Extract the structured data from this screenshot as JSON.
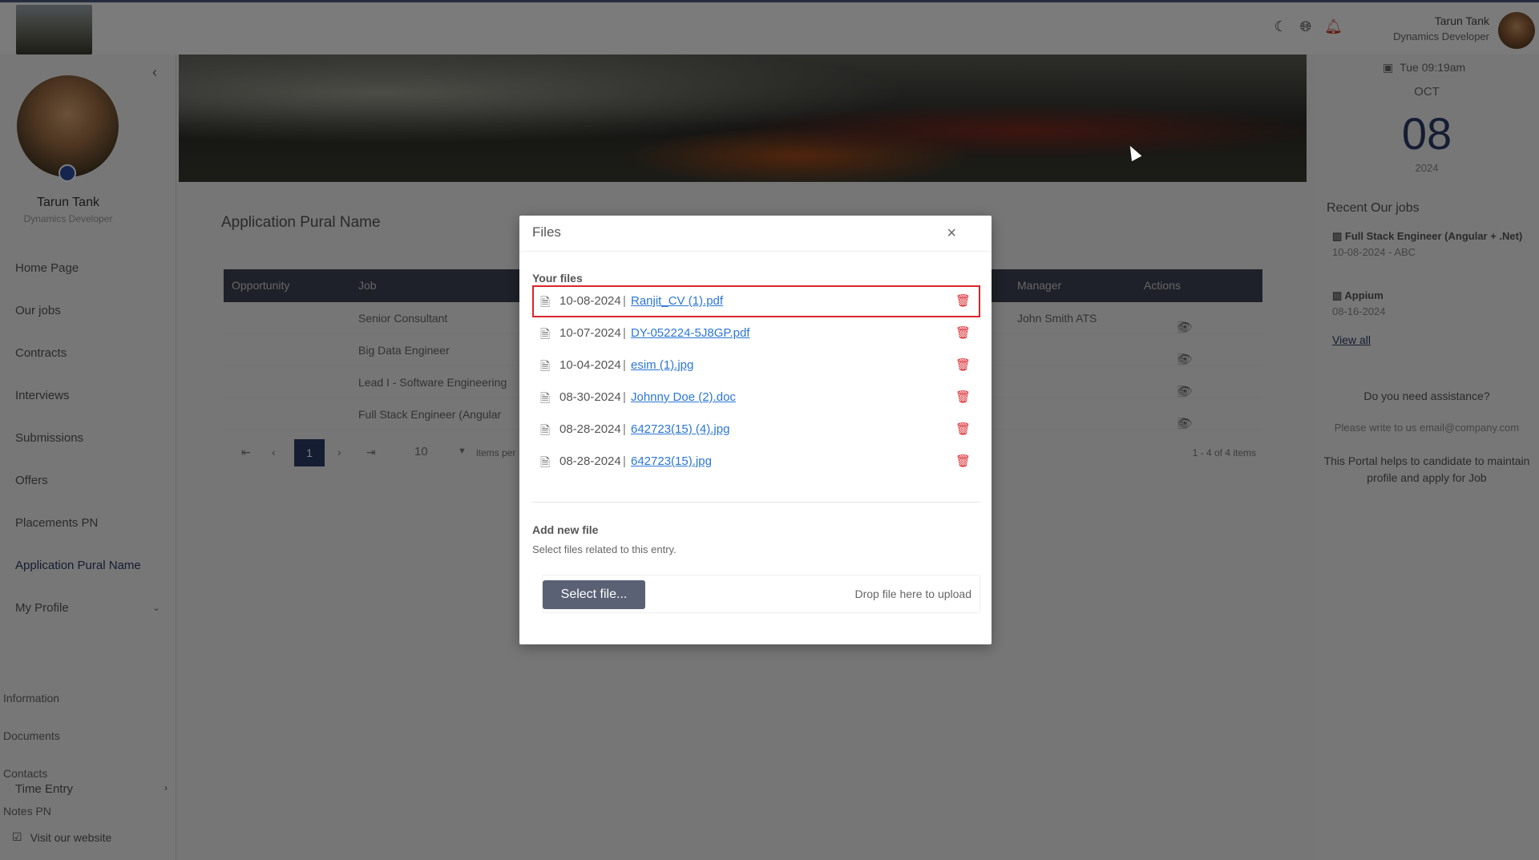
{
  "header": {
    "user_name": "Tarun Tank",
    "user_role": "Dynamics Developer",
    "icons": [
      "moon-icon",
      "globe-icon",
      "bell-icon"
    ]
  },
  "sidebar": {
    "profile_name": "Tarun Tank",
    "profile_role": "Dynamics Developer",
    "items": [
      {
        "label": "Home Page"
      },
      {
        "label": "Our jobs"
      },
      {
        "label": "Contracts"
      },
      {
        "label": "Interviews"
      },
      {
        "label": "Submissions"
      },
      {
        "label": "Offers"
      },
      {
        "label": "Placements PN"
      },
      {
        "label": "Application Pural Name"
      },
      {
        "label": "My Profile"
      }
    ],
    "subitems": [
      {
        "label": "Information"
      },
      {
        "label": "Documents"
      },
      {
        "label": "Contacts"
      },
      {
        "label": "Notes PN"
      }
    ],
    "time_entry": "Time Entry",
    "visit_site": "Visit our website"
  },
  "main": {
    "page_title": "Application Pural Name",
    "grid": {
      "headers": [
        "Opportunity",
        "Job",
        "Manager",
        "Actions"
      ],
      "rows": [
        {
          "job": "Senior Consultant",
          "manager": "John Smith ATS"
        },
        {
          "job": "Big Data Engineer",
          "manager": ""
        },
        {
          "job": "Lead I - Software Engineering",
          "manager": ""
        },
        {
          "job": "Full Stack Engineer (Angular",
          "manager": ""
        }
      ]
    },
    "pager": {
      "current_page": "1",
      "page_size": "10",
      "per_page_label": "items per",
      "count_label": "1 - 4 of 4 items"
    }
  },
  "right": {
    "date_line": "Tue 09:19am",
    "month": "OCT",
    "day": "08",
    "year": "2024",
    "recent_title": "Recent Our jobs",
    "jobs": [
      {
        "title": "Full Stack Engineer (Angular + .Net)",
        "meta": "10-08-2024 - ABC"
      },
      {
        "title": "Appium",
        "meta": "08-16-2024"
      }
    ],
    "view_all": "View all",
    "assist_title": "Do you need assistance?",
    "assist_mail": "Please write to us email@company.com",
    "assist_text": "This Portal helps to candidate to maintain profile and apply for Job"
  },
  "modal": {
    "title": "Files",
    "close_label": "×",
    "your_files_label": "Your files",
    "files": [
      {
        "date": "10-08-2024",
        "name": "Ranjit_CV (1).pdf"
      },
      {
        "date": "10-07-2024",
        "name": "DY-052224-5J8GP.pdf"
      },
      {
        "date": "10-04-2024",
        "name": "esim (1).jpg"
      },
      {
        "date": "08-30-2024",
        "name": "Johnny Doe (2).doc"
      },
      {
        "date": "08-28-2024",
        "name": "642723(15) (4).jpg"
      },
      {
        "date": "08-28-2024",
        "name": "642723(15).jpg"
      }
    ],
    "separator": "|",
    "add_title": "Add new file",
    "add_hint": "Select files related to this entry.",
    "select_button": "Select file...",
    "drop_text": "Drop file here to upload"
  },
  "colors": {
    "accent": "#2a3b66",
    "link": "#2b76d6",
    "danger": "#d9262b",
    "button": "#5a6175"
  }
}
